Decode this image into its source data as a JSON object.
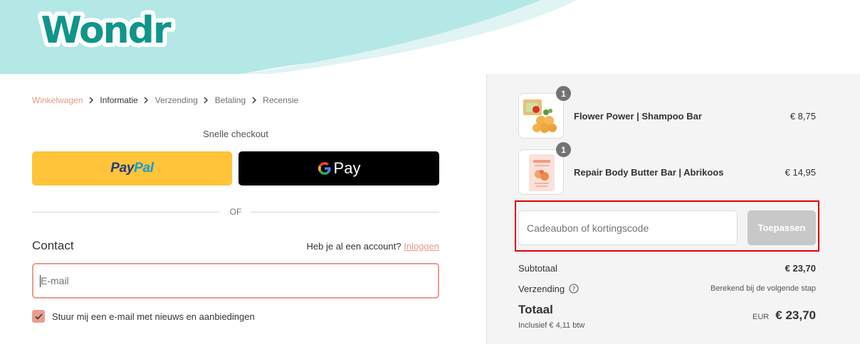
{
  "brand": {
    "logo_text": "Wondr",
    "teal": "#b4e8e6",
    "logo_color": "#10958a"
  },
  "breadcrumb": [
    {
      "label": "Winkelwagen",
      "state": "link"
    },
    {
      "label": "Informatie",
      "state": "current"
    },
    {
      "label": "Verzending",
      "state": "upcoming"
    },
    {
      "label": "Betaling",
      "state": "upcoming"
    },
    {
      "label": "Recensie",
      "state": "upcoming"
    }
  ],
  "express": {
    "title": "Snelle checkout",
    "paypal_part1": "Pay",
    "paypal_part2": "Pal",
    "gpay_label": "Pay",
    "divider": "OF"
  },
  "contact": {
    "title": "Contact",
    "account_prompt": "Heb je al een account?",
    "login_link": "Inloggen",
    "email_placeholder": "E-mail",
    "newsletter_label": "Stuur mij een e-mail met nieuws en aanbiedingen",
    "newsletter_checked": true
  },
  "cart": {
    "items": [
      {
        "name": "Flower Power | Shampoo Bar",
        "price": "€ 8,75",
        "qty": "1",
        "thumb_icon": "shampoo-bar-image"
      },
      {
        "name": "Repair Body Butter Bar | Abrikoos",
        "price": "€ 14,95",
        "qty": "1",
        "thumb_icon": "body-butter-image"
      }
    ],
    "discount_placeholder": "Cadeaubon of kortingscode",
    "apply_label": "Toepassen",
    "subtotal_label": "Subtotaal",
    "subtotal_value": "€ 23,70",
    "shipping_label": "Verzending",
    "shipping_value": "Berekend bij de volgende stap",
    "total_label": "Totaal",
    "tax_note": "Inclusief € 4,11 btw",
    "currency": "EUR",
    "total_value": "€ 23,70"
  }
}
